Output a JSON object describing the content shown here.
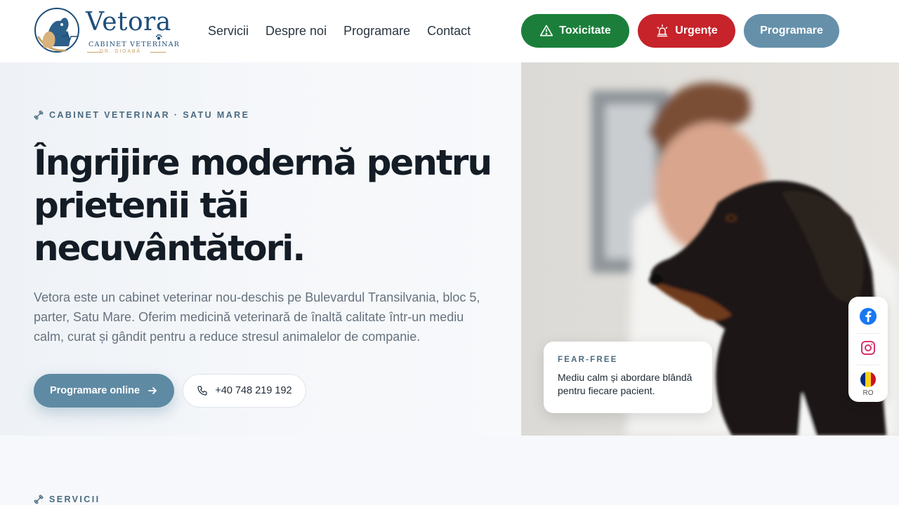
{
  "brand": {
    "name": "Vetora",
    "subtitle": "CABINET VETERINAR",
    "doctor": "DR. GIOABĂ",
    "colors": {
      "navy": "#1d4e7a",
      "gold": "#c6a366"
    }
  },
  "nav": {
    "items": [
      {
        "label": "Servicii"
      },
      {
        "label": "Despre noi"
      },
      {
        "label": "Programare"
      },
      {
        "label": "Contact"
      }
    ]
  },
  "header_buttons": {
    "toxicity": {
      "label": "Toxicitate",
      "icon": "warning-triangle-icon",
      "color": "#1b7f3b"
    },
    "emergency": {
      "label": "Urgențe",
      "icon": "siren-icon",
      "color": "#c6232a"
    },
    "booking": {
      "label": "Programare",
      "color": "#6690aa"
    }
  },
  "hero": {
    "eyebrow": "CABINET VETERINAR · SATU MARE",
    "headline": "Îngrijire modernă pentru prietenii tăi necuvântători.",
    "lead": "Vetora este un cabinet veterinar nou-deschis pe Bulevardul Transilvania, bloc 5, parter, Satu Mare. Oferim medicină veterinară de înaltă calitate într-un mediu calm, curat și gândit pentru a reduce stresul animalelor de companie.",
    "cta_primary": "Programare online",
    "cta_phone": "+40 748 219 192"
  },
  "fear_free": {
    "title": "FEAR-FREE",
    "text": "Mediu calm și abordare blândă pentru fiecare pacient."
  },
  "social": {
    "facebook": "facebook-icon",
    "instagram": "instagram-icon",
    "language": "RO"
  },
  "services_section": {
    "eyebrow": "SERVICII"
  }
}
